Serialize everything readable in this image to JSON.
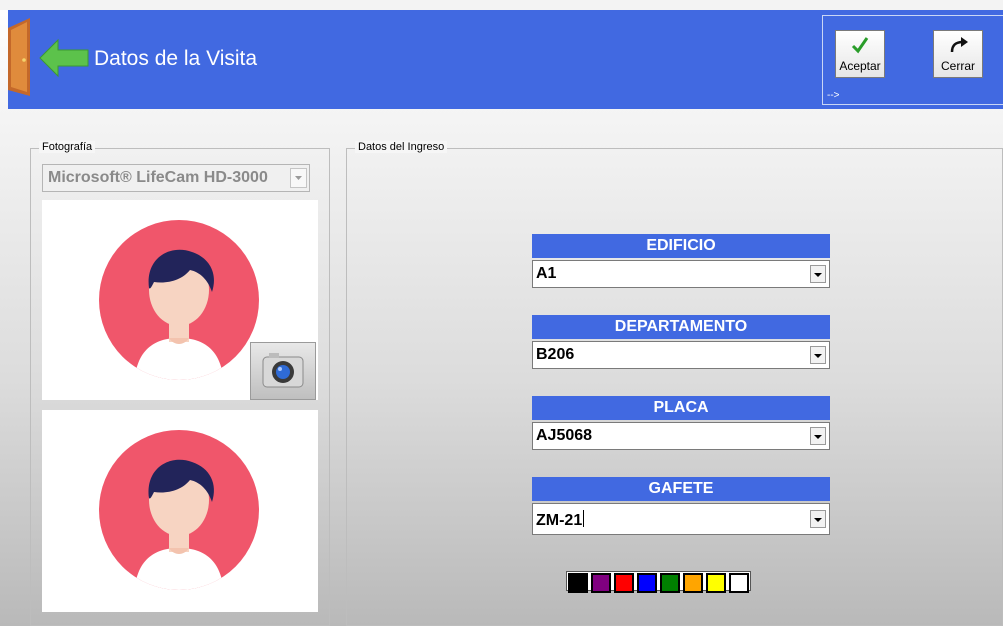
{
  "header": {
    "title": "Datos de la Visita",
    "toolbar": {
      "accept_label": "Aceptar",
      "close_label": "Cerrar",
      "overflow_label": "-->"
    }
  },
  "photo_group": {
    "title": "Fotografía",
    "camera": "Microsoft® LifeCam HD-3000"
  },
  "entry_group": {
    "title": "Datos del Ingreso",
    "fields": [
      {
        "label": "EDIFICIO",
        "value": "A1"
      },
      {
        "label": "DEPARTAMENTO",
        "value": "B206"
      },
      {
        "label": "PLACA",
        "value": "AJ5068"
      },
      {
        "label": "GAFETE",
        "value": "ZM-21"
      }
    ]
  },
  "badge_colors": [
    "#000000",
    "#800080",
    "#ff0000",
    "#0000ff",
    "#008000",
    "#ffa500",
    "#ffff00",
    "#ffffff"
  ],
  "colors": {
    "header_bg": "#4169e1",
    "label_bg": "#4169e1",
    "avatar_circle": "#f0566b",
    "avatar_hair": "#22245a",
    "avatar_skin": "#f7d4c2"
  }
}
